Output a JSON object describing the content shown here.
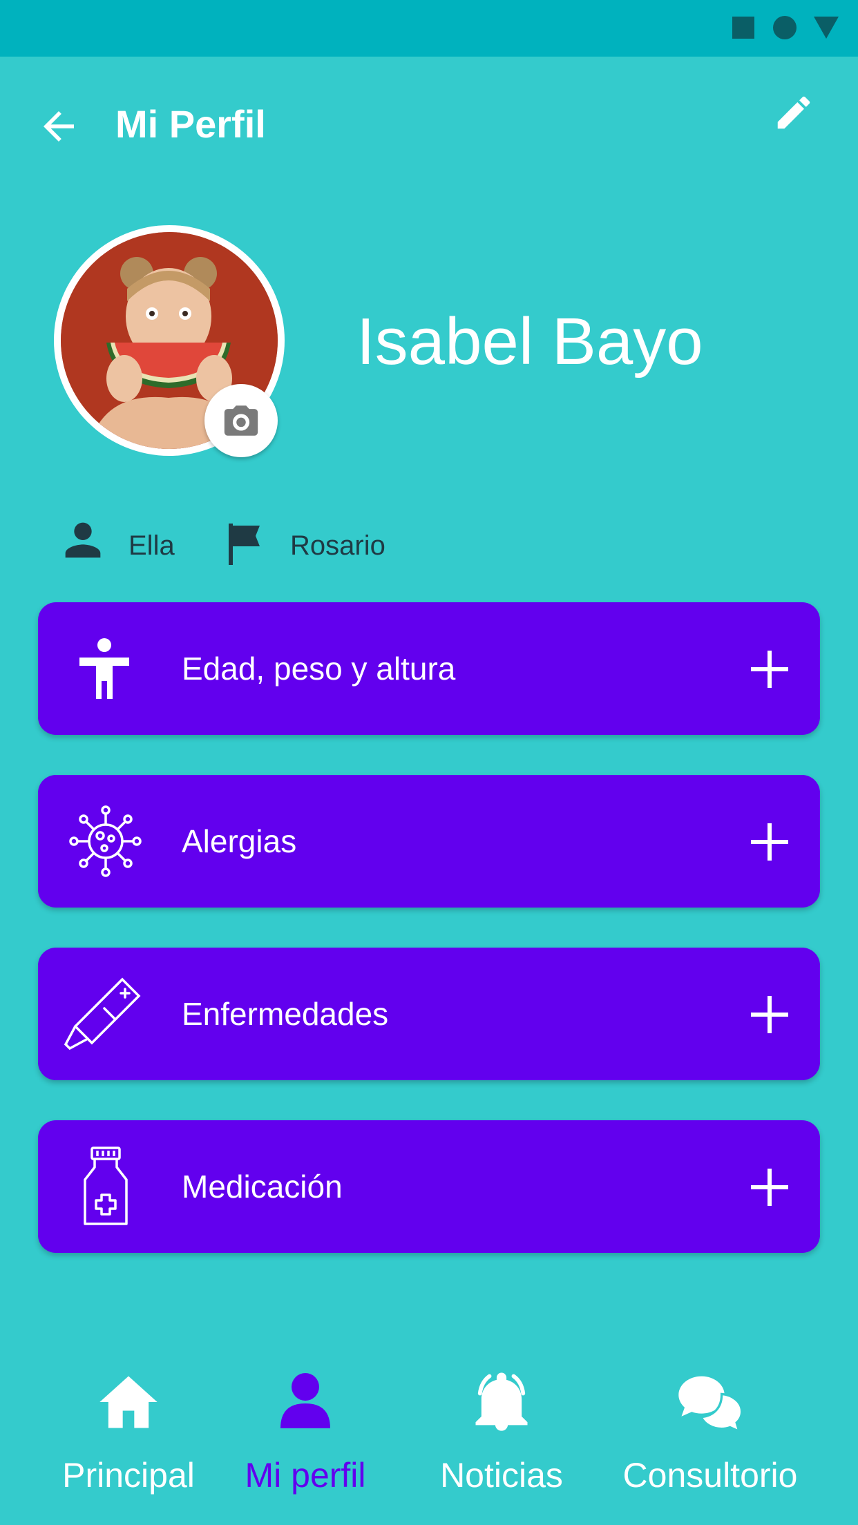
{
  "colors": {
    "background": "#34CBCC",
    "statusbar": "#00B2BE",
    "accent": "#6200EE",
    "text_dark": "#1F3A44"
  },
  "appbar": {
    "title": "Mi Perfil",
    "back_icon": "arrow-back-icon",
    "edit_icon": "pencil-icon"
  },
  "profile": {
    "name": "Isabel Bayo",
    "pronoun": "Ella",
    "city": "Rosario",
    "pronoun_icon": "person-icon",
    "city_icon": "flag-icon",
    "camera_icon": "camera-icon"
  },
  "cards": [
    {
      "label": "Edad, peso y altura",
      "icon": "body-figure-icon"
    },
    {
      "label": "Alergias",
      "icon": "virus-icon"
    },
    {
      "label": "Enfermedades",
      "icon": "thermometer-icon"
    },
    {
      "label": "Medicación",
      "icon": "medicine-bottle-icon"
    }
  ],
  "bottom_nav": [
    {
      "label": "Principal",
      "icon": "home-icon",
      "active": false
    },
    {
      "label": "Mi perfil",
      "icon": "person-icon",
      "active": true
    },
    {
      "label": "Noticias",
      "icon": "bell-icon",
      "active": false
    },
    {
      "label": "Consultorio",
      "icon": "chat-bubbles-icon",
      "active": false
    }
  ]
}
